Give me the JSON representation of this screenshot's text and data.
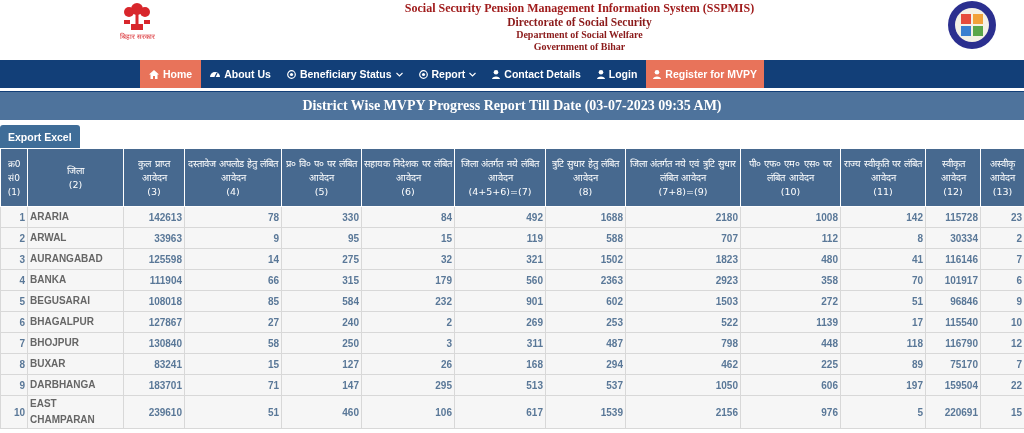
{
  "header": {
    "system_title": "Social Security Pension Management Information System (SSPMIS)",
    "lines": [
      "Directorate of Social Security",
      "Department of Social Welfare",
      "Government of Bihar"
    ],
    "emblem_caption": "बिहार सरकार"
  },
  "nav": [
    {
      "label": "Home",
      "kind": "link",
      "dropdown": false,
      "selected": true
    },
    {
      "label": "About Us",
      "kind": "link",
      "dropdown": false,
      "selected": false
    },
    {
      "label": "Beneficiary Status",
      "kind": "link",
      "dropdown": true,
      "selected": false
    },
    {
      "label": "Report",
      "kind": "link",
      "dropdown": true,
      "selected": false
    },
    {
      "label": "Contact Details",
      "kind": "link",
      "dropdown": false,
      "selected": false
    },
    {
      "label": "Login",
      "kind": "link",
      "dropdown": false,
      "selected": false
    },
    {
      "label": "Register for MVPY",
      "kind": "button",
      "dropdown": false,
      "selected": false
    }
  ],
  "report_title": "District Wise MVPY Progress Report Till Date (03-07-2023 09:35 AM)",
  "export_button": "Export Excel",
  "table": {
    "columns": [
      {
        "title": "क्र0 सं0",
        "number": "(1)"
      },
      {
        "title": "जिला",
        "number": "(2)"
      },
      {
        "title": "कुल प्राप्त आवेदन",
        "number": "(3)"
      },
      {
        "title": "दस्तावेज अपलोड हेतु लंबित आवेदन",
        "number": "(4)"
      },
      {
        "title": "प्र० वि० प० पर लंबित आवेदन",
        "number": "(5)"
      },
      {
        "title": "सहायक निदेशक पर लंबित आवेदन",
        "number": "(6)"
      },
      {
        "title": "जिला अंतर्गत नये लंबित आवेदन",
        "number": "(4+5+6)=(7)"
      },
      {
        "title": "त्रुटि सुधार हेतु लंबित आवेदन",
        "number": "(8)"
      },
      {
        "title": "जिला अंतर्गत नये एवं त्रुटि सुधार लंबित आवेदन",
        "number": "(7+8)=(9)"
      },
      {
        "title": "पी० एफ० एम० एस० पर लंबित आवेदन",
        "number": "(10)"
      },
      {
        "title": "राज्य स्वीकृति पर लंबित आवेदन",
        "number": "(11)"
      },
      {
        "title": "स्वीकृत आवेदन",
        "number": "(12)"
      },
      {
        "title": "अस्वीकृ आवेदन",
        "number": "(13)"
      }
    ],
    "rows": [
      [
        "1",
        "ARARIA",
        "142613",
        "78",
        "330",
        "84",
        "492",
        "1688",
        "2180",
        "1008",
        "142",
        "115728",
        "23"
      ],
      [
        "2",
        "ARWAL",
        "33963",
        "9",
        "95",
        "15",
        "119",
        "588",
        "707",
        "112",
        "8",
        "30334",
        "2"
      ],
      [
        "3",
        "AURANGABAD",
        "125598",
        "14",
        "275",
        "32",
        "321",
        "1502",
        "1823",
        "480",
        "41",
        "116146",
        "7"
      ],
      [
        "4",
        "BANKA",
        "111904",
        "66",
        "315",
        "179",
        "560",
        "2363",
        "2923",
        "358",
        "70",
        "101917",
        "6"
      ],
      [
        "5",
        "BEGUSARAI",
        "108018",
        "85",
        "584",
        "232",
        "901",
        "602",
        "1503",
        "272",
        "51",
        "96846",
        "9"
      ],
      [
        "6",
        "BHAGALPUR",
        "127867",
        "27",
        "240",
        "2",
        "269",
        "253",
        "522",
        "1139",
        "17",
        "115540",
        "10"
      ],
      [
        "7",
        "BHOJPUR",
        "130840",
        "58",
        "250",
        "3",
        "311",
        "487",
        "798",
        "448",
        "118",
        "116790",
        "12"
      ],
      [
        "8",
        "BUXAR",
        "83241",
        "15",
        "127",
        "26",
        "168",
        "294",
        "462",
        "225",
        "89",
        "75170",
        "7"
      ],
      [
        "9",
        "DARBHANGA",
        "183701",
        "71",
        "147",
        "295",
        "513",
        "537",
        "1050",
        "606",
        "197",
        "159504",
        "22"
      ],
      [
        "10",
        "EAST CHAMPARAN",
        "239610",
        "51",
        "460",
        "106",
        "617",
        "1539",
        "2156",
        "976",
        "5",
        "220691",
        "15"
      ]
    ]
  }
}
